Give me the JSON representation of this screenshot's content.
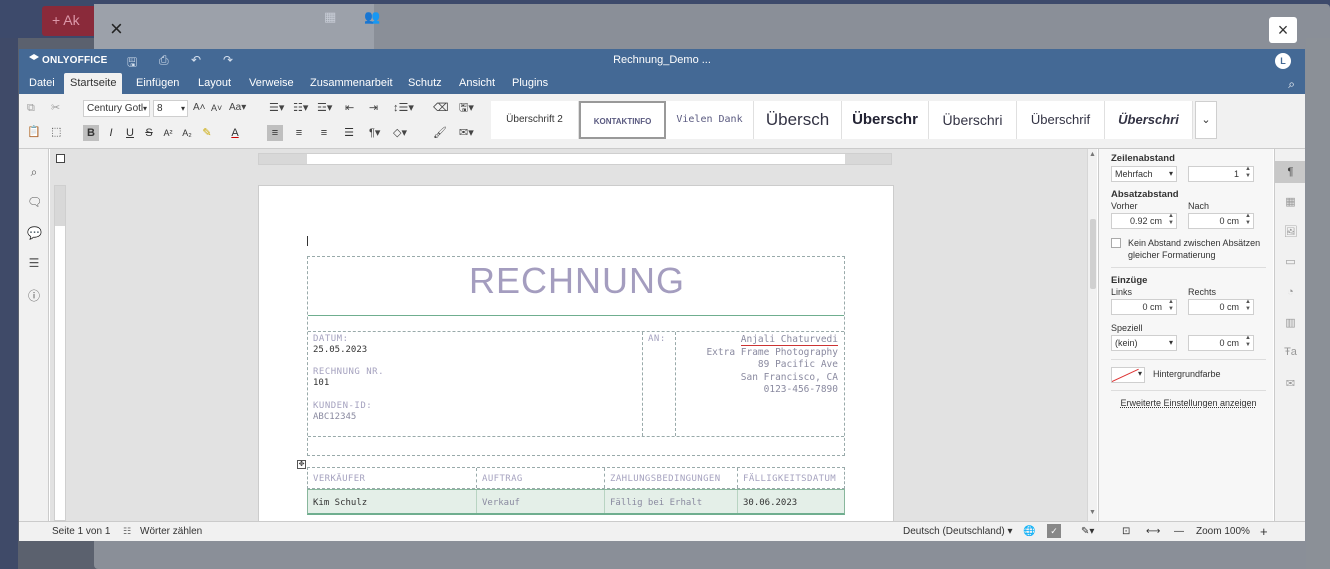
{
  "background": {
    "new_button_label": "+ Ak",
    "close_glyph": "×",
    "modal_close_glyph": "×"
  },
  "titlebar": {
    "logo_text": "ONLYOFFICE",
    "document_title": "Rechnung_Demo ...",
    "user_initial": "L",
    "quick_icons": [
      "save-icon",
      "print-icon",
      "undo-icon",
      "redo-icon"
    ]
  },
  "tabs": [
    {
      "label": "Datei"
    },
    {
      "label": "Startseite",
      "active": true
    },
    {
      "label": "Einfügen"
    },
    {
      "label": "Layout"
    },
    {
      "label": "Verweise"
    },
    {
      "label": "Zusammenarbeit"
    },
    {
      "label": "Schutz"
    },
    {
      "label": "Ansicht"
    },
    {
      "label": "Plugins"
    }
  ],
  "toolbar": {
    "font_name": "Century Gotl",
    "font_size": "8",
    "styles": [
      {
        "label": "Überschrift 2"
      },
      {
        "label": "KONTAKTINFO",
        "active": true
      },
      {
        "label": "Vielen Dank"
      },
      {
        "label": "Übersch"
      },
      {
        "label": "Überschr"
      },
      {
        "label": "Überschri"
      },
      {
        "label": "Überschrif"
      },
      {
        "label": "Überschri"
      }
    ]
  },
  "document": {
    "title": "RECHNUNG",
    "datum_label": "DATUM:",
    "datum_value": "25.05.2023",
    "rechnung_nr_label": "RECHNUNG NR.",
    "rechnung_nr_value": "101",
    "kunden_id_label": "KUNDEN-ID:",
    "kunden_id_value": "ABC12345",
    "an_label": "AN:",
    "recipient": {
      "name": "Anjali Chaturvedi",
      "company": "Extra Frame Photography",
      "street": "89 Pacific Ave",
      "city": "San Francisco, CA",
      "phone": "0123-456-7890"
    },
    "table": {
      "headers": [
        "VERKÄUFER",
        "AUFTRAG",
        "ZAHLUNGSBEDINGUNGEN",
        "FÄLLIGKEITSDATUM"
      ],
      "row": [
        "Kim Schulz",
        "Verkauf",
        "Fällig bei Erhalt",
        "30.06.2023"
      ]
    }
  },
  "right_panel": {
    "zeilenabstand_label": "Zeilenabstand",
    "zeilenabstand_mode": "Mehrfach",
    "zeilenabstand_value": "1",
    "absatzabstand_label": "Absatzabstand",
    "vorher_label": "Vorher",
    "vorher_value": "0.92 cm",
    "nach_label": "Nach",
    "nach_value": "0 cm",
    "kein_abstand_label": "Kein Abstand zwischen Absätzen gleicher Formatierung",
    "kein_abstand_line1": "Kein Abstand zwischen Absätzen",
    "kein_abstand_line2": "gleicher Formatierung",
    "einzuege_label": "Einzüge",
    "links_label": "Links",
    "links_value": "0 cm",
    "rechts_label": "Rechts",
    "rechts_value": "0 cm",
    "speziell_label": "Speziell",
    "speziell_mode": "(kein)",
    "speziell_value": "0 cm",
    "hintergrund_label": "Hintergrundfarbe",
    "erweitert_link": "Erweiterte Einstellungen anzeigen"
  },
  "statusbar": {
    "page_info": "Seite 1 von 1",
    "word_count": "Wörter zählen",
    "language": "Deutsch (Deutschland)",
    "zoom": "Zoom 100%"
  },
  "colors": {
    "titlebar": "#446995",
    "title_text": "#a49dbf",
    "table_row_bg": "#e4efe8"
  }
}
